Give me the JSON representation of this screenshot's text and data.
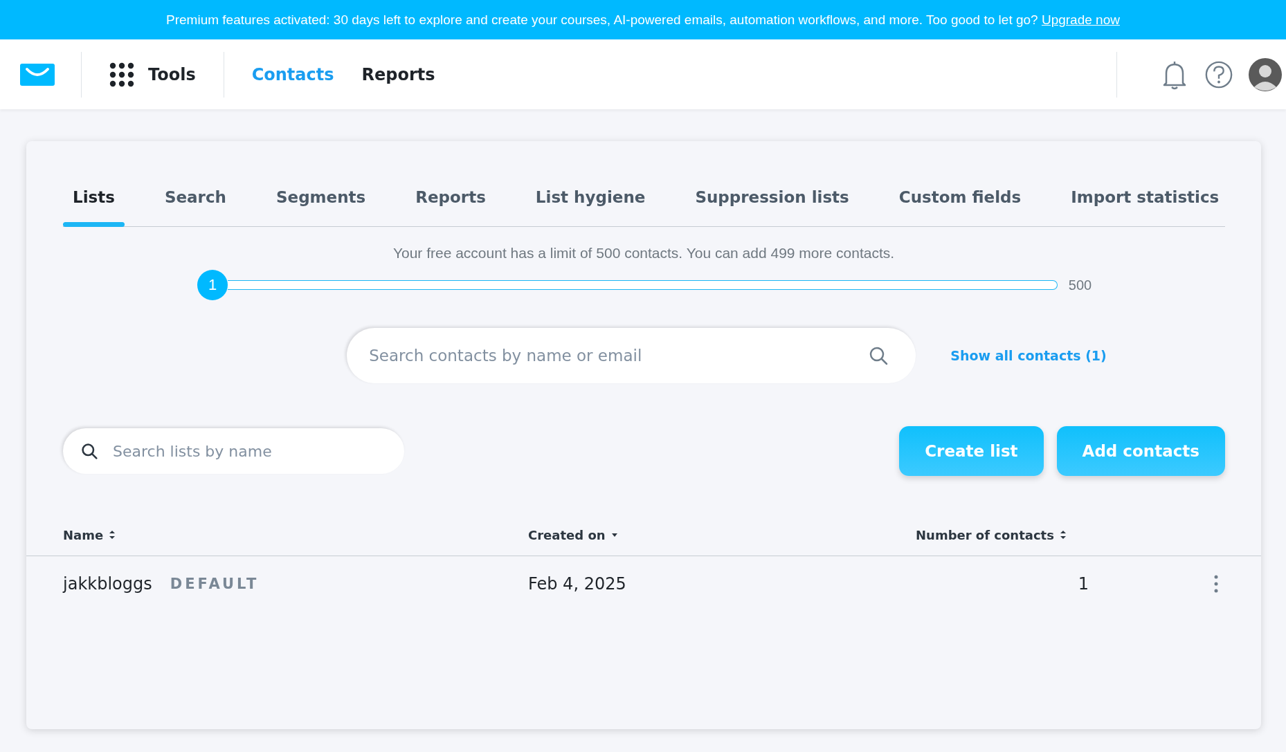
{
  "banner": {
    "text": "Premium features activated: 30 days left to explore and create your courses, AI-powered emails, automation workflows, and more. Too good to let go?",
    "link": "Upgrade now"
  },
  "header": {
    "tools": "Tools",
    "nav": [
      {
        "label": "Contacts",
        "selected": true
      },
      {
        "label": "Reports",
        "selected": false
      }
    ]
  },
  "tabs": [
    {
      "label": "Lists",
      "selected": true
    },
    {
      "label": "Search",
      "selected": false
    },
    {
      "label": "Segments",
      "selected": false
    },
    {
      "label": "Reports",
      "selected": false
    },
    {
      "label": "List hygiene",
      "selected": false
    },
    {
      "label": "Suppression lists",
      "selected": false
    },
    {
      "label": "Custom fields",
      "selected": false
    },
    {
      "label": "Import statistics",
      "selected": false
    }
  ],
  "limit": {
    "text": "Your free account has a limit of 500 contacts. You can add 499 more contacts.",
    "count": "1",
    "max": "500",
    "level": 0.002
  },
  "contact_search": {
    "placeholder": "Search contacts by name or email",
    "link": "Show all contacts (1)"
  },
  "list_search": {
    "placeholder": "Search lists by name"
  },
  "buttons": [
    "Create list",
    "Add contacts"
  ],
  "table": {
    "columns": [
      {
        "label": "Name",
        "sorted": false
      },
      {
        "label": "Created on",
        "sorted": true
      },
      {
        "label": "Number of contacts",
        "sorted": false
      }
    ],
    "rows": [
      {
        "name": "jakkbloggs",
        "badge": "DEFAULT",
        "created": "Feb 4, 2025",
        "contacts": "1"
      }
    ]
  }
}
